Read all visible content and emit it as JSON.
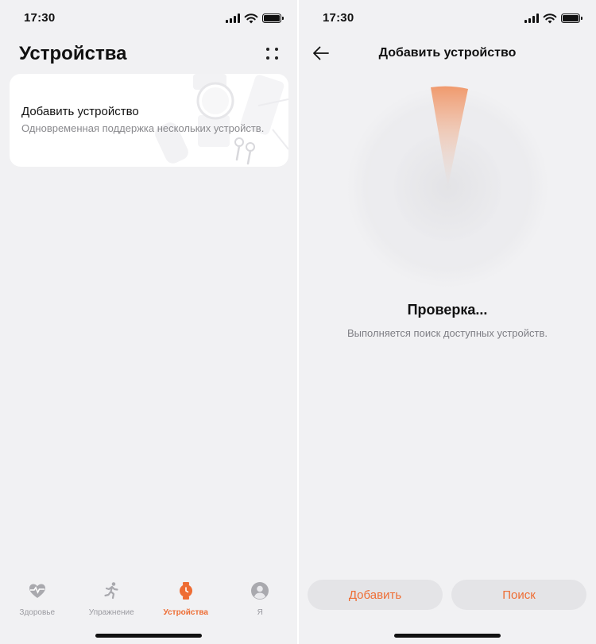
{
  "status_bar": {
    "time": "17:30"
  },
  "devices_screen": {
    "title": "Устройства",
    "add_card": {
      "title": "Добавить устройство",
      "subtitle": "Одновременная поддержка нескольких устройств."
    },
    "tab_bar": {
      "items": [
        {
          "label": "Здоровье",
          "icon": "heart-pulse-icon",
          "active": false
        },
        {
          "label": "Упражнение",
          "icon": "running-icon",
          "active": false
        },
        {
          "label": "Устройства",
          "icon": "watch-icon",
          "active": true
        },
        {
          "label": "Я",
          "icon": "avatar-icon",
          "active": false
        }
      ]
    }
  },
  "add_device_screen": {
    "title": "Добавить устройство",
    "scan_status": "Проверка...",
    "scan_message": "Выполняется поиск доступных устройств.",
    "buttons": {
      "add": "Добавить",
      "search": "Поиск"
    }
  },
  "colors": {
    "accent": "#ee6d34",
    "background": "#f1f1f3",
    "card": "#ffffff",
    "button_bg": "#e4e4e7",
    "text_primary": "#111111",
    "text_secondary": "#8a8a8e"
  }
}
